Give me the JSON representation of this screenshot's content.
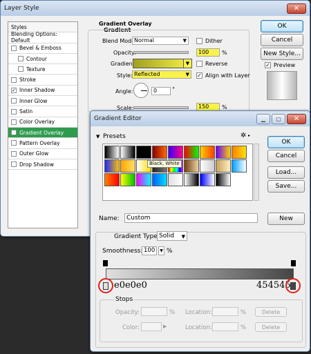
{
  "layer_style": {
    "title": "Layer Style",
    "styles_header": "Styles",
    "items": [
      {
        "label": "Blending Options: Default",
        "checkbox": false,
        "checked": false,
        "indent": false,
        "selected": false
      },
      {
        "label": "Bevel & Emboss",
        "checkbox": true,
        "checked": false,
        "indent": false,
        "selected": false
      },
      {
        "label": "Contour",
        "checkbox": true,
        "checked": false,
        "indent": true,
        "selected": false
      },
      {
        "label": "Texture",
        "checkbox": true,
        "checked": false,
        "indent": true,
        "selected": false
      },
      {
        "label": "Stroke",
        "checkbox": true,
        "checked": false,
        "indent": false,
        "selected": false
      },
      {
        "label": "Inner Shadow",
        "checkbox": true,
        "checked": true,
        "indent": false,
        "selected": false
      },
      {
        "label": "Inner Glow",
        "checkbox": true,
        "checked": false,
        "indent": false,
        "selected": false
      },
      {
        "label": "Satin",
        "checkbox": true,
        "checked": false,
        "indent": false,
        "selected": false
      },
      {
        "label": "Color Overlay",
        "checkbox": true,
        "checked": false,
        "indent": false,
        "selected": false
      },
      {
        "label": "Gradient Overlay",
        "checkbox": true,
        "checked": true,
        "indent": false,
        "selected": true
      },
      {
        "label": "Pattern Overlay",
        "checkbox": true,
        "checked": false,
        "indent": false,
        "selected": false
      },
      {
        "label": "Outer Glow",
        "checkbox": true,
        "checked": false,
        "indent": false,
        "selected": false
      },
      {
        "label": "Drop Shadow",
        "checkbox": true,
        "checked": false,
        "indent": false,
        "selected": false
      }
    ],
    "section_title": "Gradient Overlay",
    "group_title": "Gradient",
    "blend_mode_label": "Blend Mode:",
    "blend_mode_value": "Normal",
    "dither_label": "Dither",
    "opacity_label": "Opacity:",
    "opacity_value": "100",
    "percent": "%",
    "gradient_label": "Gradient:",
    "reverse_label": "Reverse",
    "style_label": "Style:",
    "style_value": "Reflected",
    "align_label": "Align with Layer",
    "angle_label": "Angle:",
    "angle_value": "0",
    "degree": "°",
    "scale_label": "Scale:",
    "scale_value": "150",
    "ok": "OK",
    "cancel": "Cancel",
    "new_style": "New Style...",
    "preview_label": "Preview"
  },
  "gradient_editor": {
    "title": "Gradient Editor",
    "presets_label": "Presets",
    "tooltip": "Black, White",
    "ok": "OK",
    "cancel": "Cancel",
    "load": "Load...",
    "save": "Save...",
    "name_label": "Name:",
    "name_value": "Custom",
    "new_button": "New",
    "gradient_type_label": "Gradient Type:",
    "gradient_type_value": "Solid",
    "smoothness_label": "Smoothness:",
    "smoothness_value": "100",
    "percent": "%",
    "left_color_code": "e0e0e0",
    "right_color_code": "454545",
    "stops_label": "Stops",
    "opacity_label": "Opacity:",
    "location_label": "Location:",
    "color_label": "Color:",
    "delete_label": "Delete"
  },
  "colors": {
    "left_stop": "#e0e0e0",
    "right_stop": "#454545",
    "highlight": "#f8f24a",
    "selected_style": "#2f9b4e",
    "annotation_circle": "#e0201a"
  }
}
